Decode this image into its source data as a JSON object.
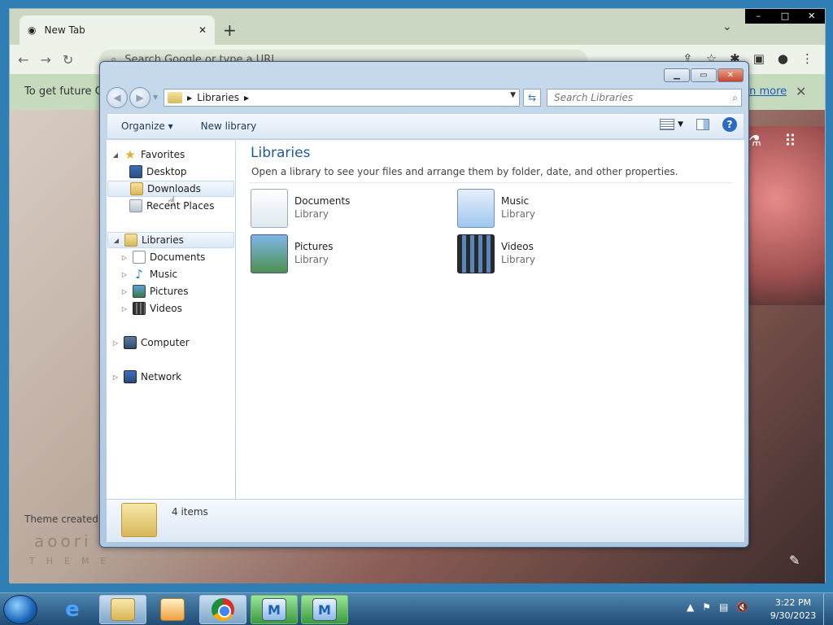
{
  "chrome": {
    "tab_title": "New Tab",
    "new_tab_label": "+",
    "tab_list_label": "⌄",
    "win_min": "–",
    "win_max": "□",
    "win_close": "✕",
    "omnibox_placeholder": "Search Google or type a URL",
    "info_text": "To get future Go",
    "info_link": "rn more",
    "info_close": "✕",
    "theme_credit": "Theme created b",
    "theme_logo": "aoori",
    "theme_sub": "THEME"
  },
  "explorer": {
    "breadcrumb": "Libraries",
    "search_placeholder": "Search Libraries",
    "toolbar": {
      "organize": "Organize ▾",
      "new_library": "New library"
    },
    "nav": {
      "favorites": "Favorites",
      "desktop": "Desktop",
      "downloads": "Downloads",
      "recent": "Recent Places",
      "libraries": "Libraries",
      "documents": "Documents",
      "music": "Music",
      "pictures": "Pictures",
      "videos": "Videos",
      "computer": "Computer",
      "network": "Network"
    },
    "main": {
      "title": "Libraries",
      "subtitle": "Open a library to see your files and arrange them by folder, date, and other properties.",
      "items": [
        {
          "name": "Documents",
          "type": "Library",
          "icon": "documents-library-icon"
        },
        {
          "name": "Music",
          "type": "Library",
          "icon": "music-library-icon"
        },
        {
          "name": "Pictures",
          "type": "Library",
          "icon": "pictures-library-icon"
        },
        {
          "name": "Videos",
          "type": "Library",
          "icon": "videos-library-icon"
        }
      ]
    },
    "details": {
      "count": "4 items"
    }
  },
  "taskbar": {
    "time": "3:22 PM",
    "date": "9/30/2023"
  }
}
